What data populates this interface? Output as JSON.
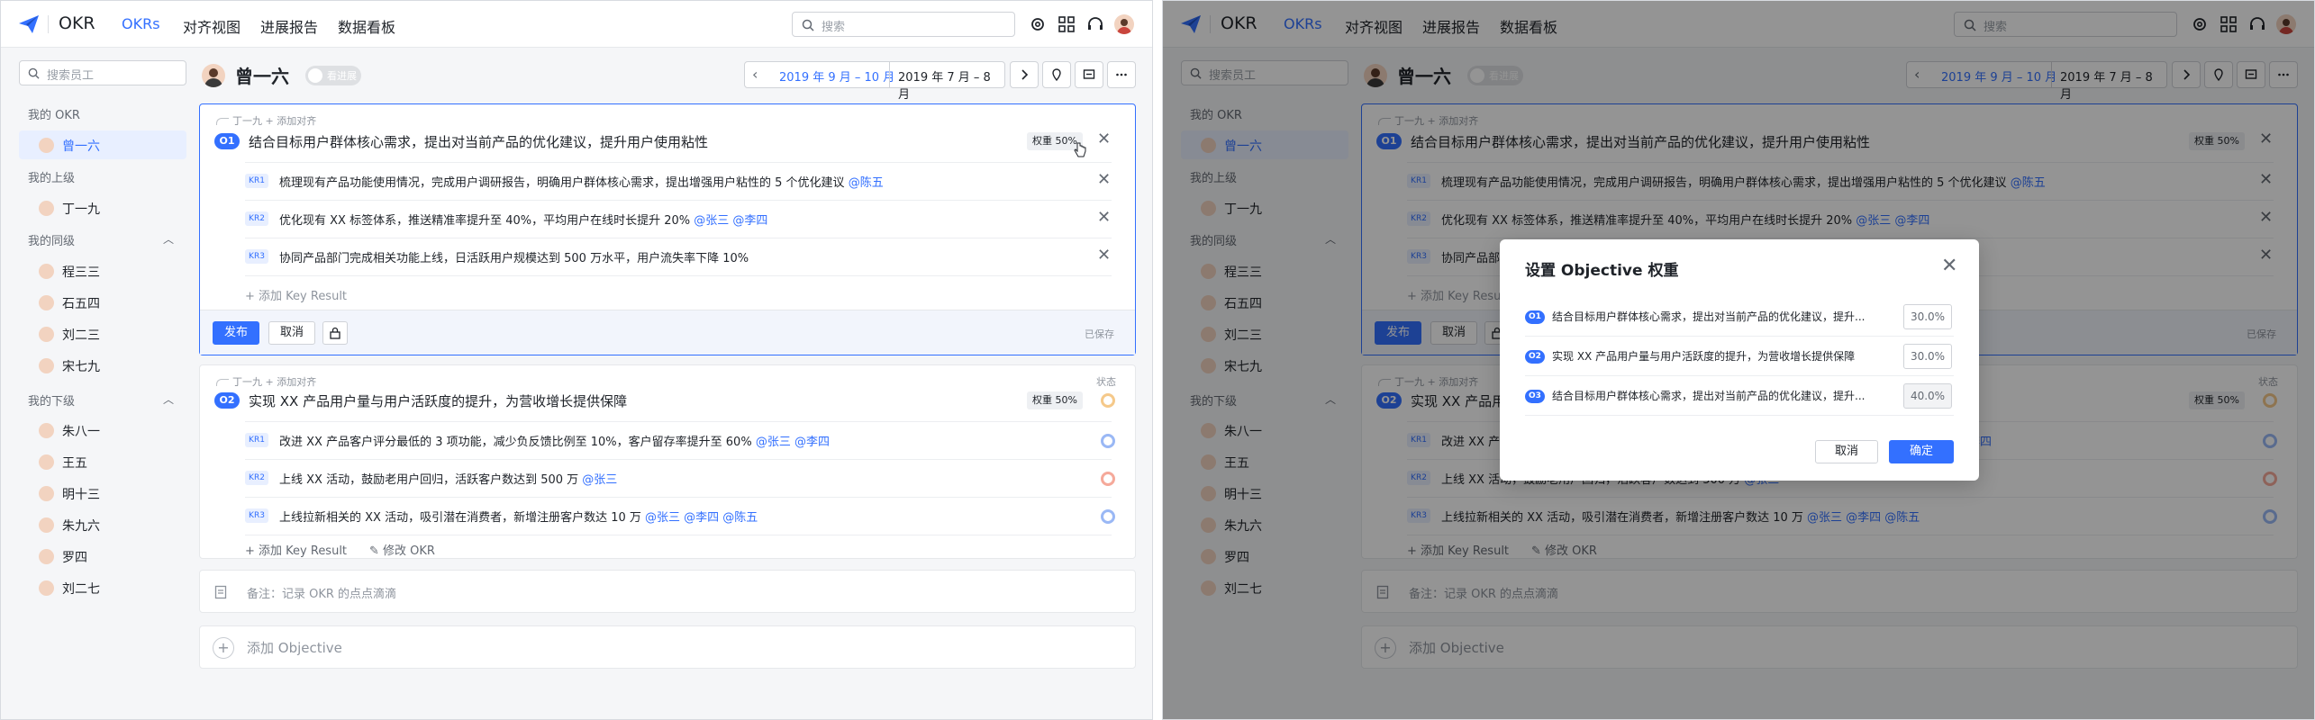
{
  "app": {
    "name": "OKR",
    "nav": [
      "OKRs",
      "对齐视图",
      "进展报告",
      "数据看板"
    ],
    "active_nav": 0,
    "search_placeholder": "搜索"
  },
  "sidebar": {
    "search_placeholder": "搜索员工",
    "groups": [
      {
        "label": "我的 OKR",
        "collapsible": false,
        "items": [
          {
            "name": "曾一六",
            "active": true
          }
        ]
      },
      {
        "label": "我的上级",
        "collapsible": false,
        "items": [
          {
            "name": "丁一九"
          }
        ]
      },
      {
        "label": "我的同级",
        "collapsible": true,
        "items": [
          {
            "name": "程三三"
          },
          {
            "name": "石五四"
          },
          {
            "name": "刘二三"
          },
          {
            "name": "宋七九"
          }
        ]
      },
      {
        "label": "我的下级",
        "collapsible": true,
        "items": [
          {
            "name": "朱八一"
          },
          {
            "name": "王五"
          },
          {
            "name": "明十三"
          },
          {
            "name": "朱九六"
          },
          {
            "name": "罗四"
          },
          {
            "name": "刘二七"
          }
        ]
      }
    ]
  },
  "main": {
    "person_name": "曾一六",
    "progress_toggle_label": "看进展",
    "periods": [
      "2019 年 9 月 – 10 月",
      "2019 年 7 月 – 8 月"
    ],
    "objectives": [
      {
        "badge": "O1",
        "align_owner": "丁一九",
        "align_action": "+ 添加对齐",
        "title": "结合目标用户群体核心需求，提出对当前产品的优化建议，提升用户使用粘性",
        "weight_label": "权重 50%",
        "krs": [
          {
            "badge": "KR1",
            "text": "梳理现有产品功能使用情况，完成用户调研报告，明确用户群体核心需求，提出增强用户粘性的 5 个优化建议",
            "mentions": "@陈五"
          },
          {
            "badge": "KR2",
            "text": "优化现有 XX 标签体系，推送精准率提升至 40%，平均用户在线时长提升 20%",
            "mentions": "@张三 @李四"
          },
          {
            "badge": "KR3",
            "text": "协同产品部门完成相关功能上线，日活跃用户规模达到 500 万水平，用户流失率下降 10%",
            "mentions": ""
          }
        ],
        "add_kr_label": "添加 Key Result",
        "publish_label": "发布",
        "cancel_label": "取消",
        "saved_label": "已保存"
      },
      {
        "badge": "O2",
        "align_owner": "丁一九",
        "align_action": "+ 添加对齐",
        "title": "实现 XX 产品用户量与用户活跃度的提升，为营收增长提供保障",
        "weight_label": "权重 50%",
        "status_header": "状态",
        "krs": [
          {
            "badge": "KR1",
            "text": "改进 XX 产品客户评分最低的 3 项功能，减少负反馈比例至 10%，客户留存率提升至 60%",
            "mentions": "@张三 @李四",
            "status_color": "#9ab8f5"
          },
          {
            "badge": "KR2",
            "text": "上线 XX 活动，鼓励老用户回归，活跃客户数达到 500 万",
            "mentions": "@张三",
            "status_color": "#f5a99a"
          },
          {
            "badge": "KR3",
            "text": "上线拉新相关的 XX 活动，吸引潜在消费者，新增注册客户数达 10 万",
            "mentions": "@张三 @李四 @陈五",
            "status_color": "#9ab8f5"
          }
        ],
        "o_status_color": "#f5c98a",
        "add_kr_label": "添加 Key Result",
        "edit_okr_label": "修改 OKR"
      }
    ],
    "note_placeholder": "备注：记录 OKR 的点点滴滴",
    "add_objective_label": "添加 Objective"
  },
  "modal": {
    "title": "设置 Objective 权重",
    "rows": [
      {
        "badge": "O1",
        "text": "结合目标用户群体核心需求，提出对当前产品的优化建议，提升...",
        "value": "30.0%"
      },
      {
        "badge": "O2",
        "text": "实现 XX 产品用户量与用户活跃度的提升，为营收增长提供保障",
        "value": "30.0%"
      },
      {
        "badge": "O3",
        "text": "结合目标用户群体核心需求，提出对当前产品的优化建议，提升...",
        "value": "40.0%",
        "disabled": true
      }
    ],
    "cancel_label": "取消",
    "confirm_label": "确定"
  },
  "colors": {
    "accent": "#3370ff",
    "overlay": "rgba(0,0,0,0.42)"
  }
}
